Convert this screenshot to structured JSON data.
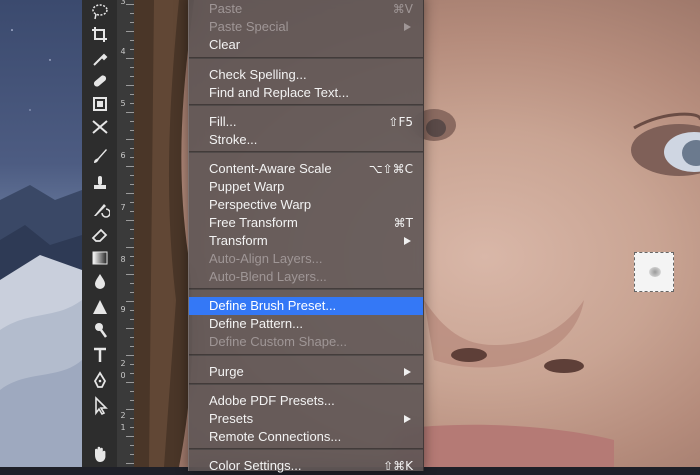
{
  "menu": {
    "items": [
      {
        "label": "Paste",
        "shortcut": "⌘V",
        "disabled": true
      },
      {
        "label": "Paste Special",
        "disabled": true,
        "submenu": true
      },
      {
        "label": "Clear"
      },
      {
        "label": "Check Spelling..."
      },
      {
        "label": "Find and Replace Text..."
      },
      {
        "label": "Fill...",
        "shortcut": "⇧F5"
      },
      {
        "label": "Stroke..."
      },
      {
        "label": "Content-Aware Scale",
        "shortcut": "⌥⇧⌘C"
      },
      {
        "label": "Puppet Warp"
      },
      {
        "label": "Perspective Warp"
      },
      {
        "label": "Free Transform",
        "shortcut": "⌘T"
      },
      {
        "label": "Transform",
        "submenu": true
      },
      {
        "label": "Auto-Align Layers...",
        "disabled": true
      },
      {
        "label": "Auto-Blend Layers...",
        "disabled": true
      },
      {
        "label": "Define Brush Preset...",
        "highlighted": true
      },
      {
        "label": "Define Pattern..."
      },
      {
        "label": "Define Custom Shape...",
        "disabled": true
      },
      {
        "label": "Purge",
        "submenu": true
      },
      {
        "label": "Adobe PDF Presets..."
      },
      {
        "label": "Presets",
        "submenu": true
      },
      {
        "label": "Remote Connections..."
      },
      {
        "label": "Color Settings...",
        "shortcut": "⇧⌘K"
      }
    ]
  },
  "ruler": {
    "numbers": [
      "3",
      "4",
      "5",
      "6",
      "7",
      "8",
      "9",
      "2",
      "0",
      "2",
      "1"
    ]
  },
  "toolbar": {
    "tools": [
      "lasso-icon",
      "crop-icon",
      "eyedropper-icon",
      "healing-brush-icon",
      "patch-icon",
      "frame-icon",
      "brush-icon",
      "stamp-icon",
      "history-brush-icon",
      "eraser-icon",
      "gradient-icon",
      "blur-icon",
      "sharpen-icon",
      "dodge-icon",
      "type-icon",
      "pen-icon",
      "path-select-icon",
      "hand-icon"
    ]
  },
  "colors": {
    "highlight": "#3478f6",
    "menu_bg": "#5c5454",
    "toolbar_bg": "#2d2d2d"
  }
}
